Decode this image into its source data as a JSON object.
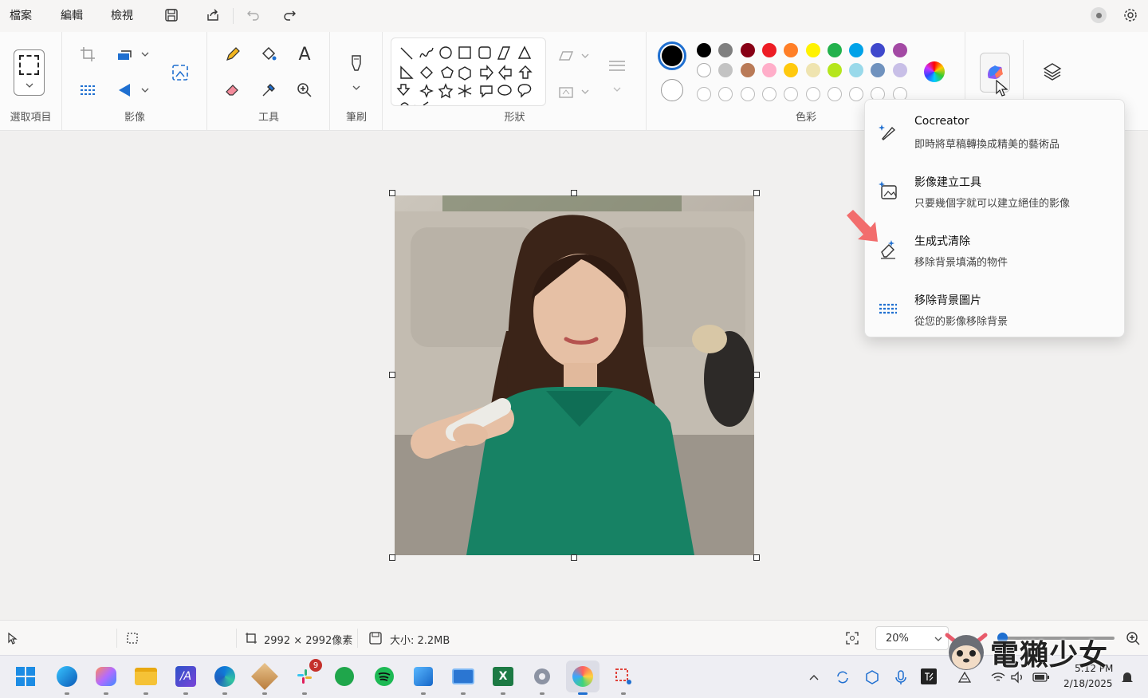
{
  "menu": {
    "file": "檔案",
    "edit": "編輯",
    "view": "檢視"
  },
  "ribbon": {
    "selection_label": "選取項目",
    "image_label": "影像",
    "tools_label": "工具",
    "brushes_label": "筆刷",
    "shapes_label": "形狀",
    "colors_label": "色彩"
  },
  "colors": {
    "primary": "#000000",
    "secondary": "#ffffff",
    "row1": [
      "#000000",
      "#7f7f7f",
      "#880015",
      "#ed1c24",
      "#ff7f27",
      "#fff200",
      "#22b14c",
      "#00a2e8",
      "#3f48cc",
      "#a349a4"
    ],
    "row2": [
      "#ffffff",
      "#c3c3c3",
      "#b97a57",
      "#ffaec9",
      "#ffc90e",
      "#efe4b0",
      "#b5e61d",
      "#99d9ea",
      "#7092be",
      "#c8bfe7"
    ]
  },
  "copilot_menu": [
    {
      "title": "Cocreator",
      "desc": "即時將草稿轉換成精美的藝術品",
      "icon": "brush-sparkle-icon"
    },
    {
      "title": "影像建立工具",
      "desc": "只要幾個字就可以建立絕佳的影像",
      "icon": "image-sparkle-icon"
    },
    {
      "title": "生成式清除",
      "desc": "移除背景填滿的物件",
      "icon": "eraser-sparkle-icon"
    },
    {
      "title": "移除背景圖片",
      "desc": "從您的影像移除背景",
      "icon": "remove-background-icon"
    }
  ],
  "status": {
    "dimensions": "2992 × 2992像素",
    "size": "大小: 2.2MB",
    "zoom": "20%"
  },
  "taskbar": {
    "badge": "9",
    "time": "5:12 PM",
    "date": "2/18/2025"
  },
  "watermark": "電獺少女"
}
